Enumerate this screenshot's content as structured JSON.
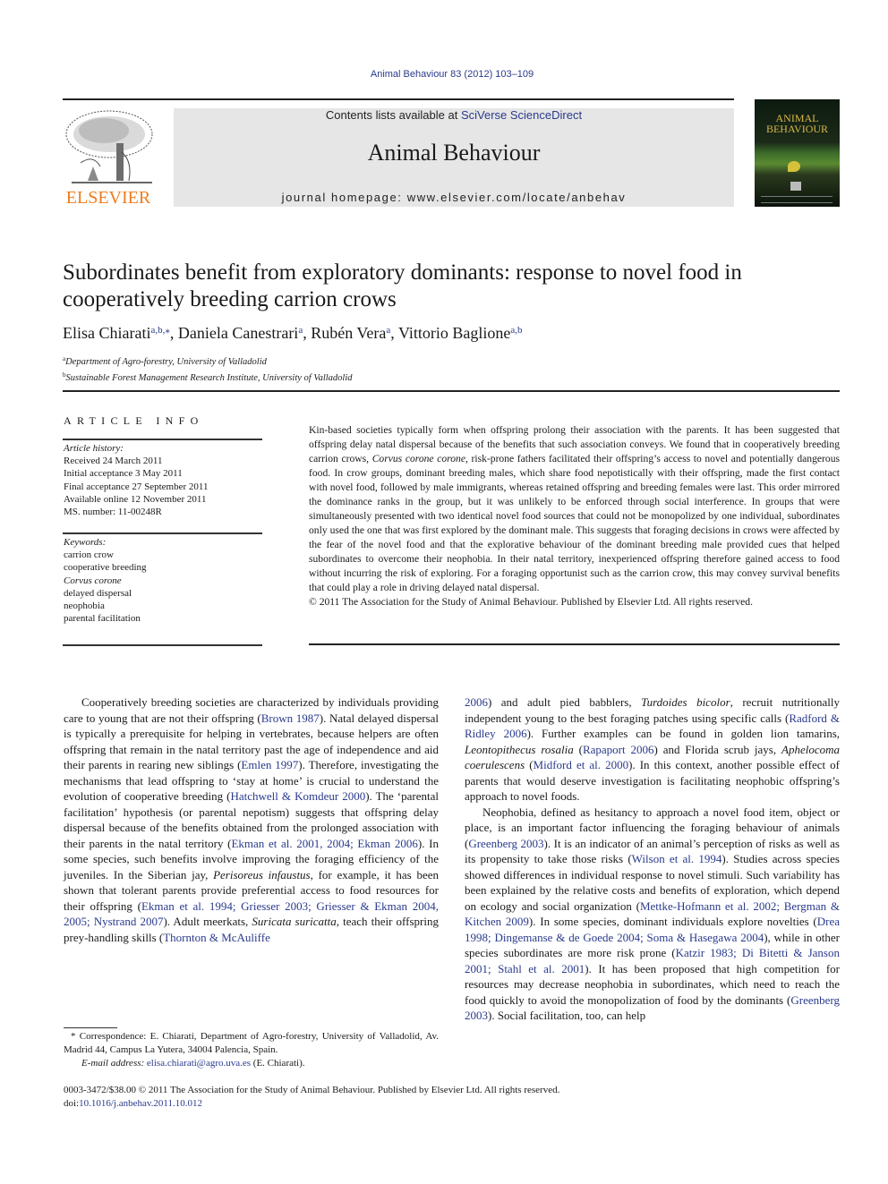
{
  "header": {
    "journal_citation": "Animal Behaviour 83 (2012) 103–109",
    "contents_prefix": "Contents lists available at ",
    "contents_link": "SciVerse ScienceDirect",
    "journal_name": "Animal Behaviour",
    "homepage_prefix": "journal homepage: ",
    "homepage_url": "www.elsevier.com/locate/anbehav",
    "publisher_logo": "ELSEVIER",
    "cover_title_line1": "ANIMAL",
    "cover_title_line2": "BEHAVIOUR"
  },
  "article": {
    "title": "Subordinates benefit from exploratory dominants: response to novel food in cooperatively breeding carrion crows",
    "authors": [
      {
        "name": "Elisa Chiarati",
        "affil": "a,b,",
        "corresponding": "⁎",
        "sep": ", "
      },
      {
        "name": "Daniela Canestrari",
        "affil": "a",
        "corresponding": "",
        "sep": ", "
      },
      {
        "name": "Rubén Vera",
        "affil": "a",
        "corresponding": "",
        "sep": ", "
      },
      {
        "name": "Vittorio Baglione",
        "affil": "a,b",
        "corresponding": "",
        "sep": ""
      }
    ],
    "affiliations": [
      {
        "mark": "a",
        "text": "Department of Agro-forestry, University of Valladolid"
      },
      {
        "mark": "b",
        "text": "Sustainable Forest Management Research Institute, University of Valladolid"
      }
    ]
  },
  "article_info": {
    "heading": "ARTICLE INFO",
    "history_label": "Article history:",
    "history": [
      "Received 24 March 2011",
      "Initial acceptance 3 May 2011",
      "Final acceptance 27 September 2011",
      "Available online 12 November 2011",
      "MS. number: 11-00248R"
    ],
    "keywords_label": "Keywords:",
    "keywords": [
      {
        "text": "carrion crow",
        "italic": false
      },
      {
        "text": "cooperative breeding",
        "italic": false
      },
      {
        "text": "Corvus corone",
        "italic": true
      },
      {
        "text": "delayed dispersal",
        "italic": false
      },
      {
        "text": "neophobia",
        "italic": false
      },
      {
        "text": "parental facilitation",
        "italic": false
      }
    ]
  },
  "abstract": {
    "p1": "Kin-based societies typically form when offspring prolong their association with the parents. It has been suggested that offspring delay natal dispersal because of the benefits that such association conveys. We found that in cooperatively breeding carrion crows, ",
    "species": "Corvus corone corone",
    "p2": ", risk-prone fathers facilitated their offspring’s access to novel and potentially dangerous food. In crow groups, dominant breeding males, which share food nepotistically with their offspring, made the first contact with novel food, followed by male immigrants, whereas retained offspring and breeding females were last. This order mirrored the dominance ranks in the group, but it was unlikely to be enforced through social interference. In groups that were simultaneously presented with two identical novel food sources that could not be monopolized by one individual, subordinates only used the one that was first explored by the dominant male. This suggests that foraging decisions in crows were affected by the fear of the novel food and that the explorative behaviour of the dominant breeding male provided cues that helped subordinates to overcome their neophobia. In their natal territory, inexperienced offspring therefore gained access to food without incurring the risk of exploring. For a foraging opportunist such as the carrion crow, this may convey survival benefits that could play a role in driving delayed natal dispersal.",
    "copyright": "© 2011 The Association for the Study of Animal Behaviour. Published by Elsevier Ltd. All rights reserved."
  },
  "body": {
    "left": [
      {
        "t": "Cooperatively breeding societies are characterized by individuals providing care to young that are not their offspring ("
      },
      {
        "link": "Brown 1987"
      },
      {
        "t": "). Natal delayed dispersal is typically a prerequisite for helping in vertebrates, because helpers are often offspring that remain in the natal territory past the age of independence and aid their parents in rearing new siblings ("
      },
      {
        "link": "Emlen 1997"
      },
      {
        "t": "). Therefore, investigating the mechanisms that lead offspring to ‘stay at home’ is crucial to understand the evolution of cooperative breeding ("
      },
      {
        "link": "Hatchwell & Komdeur 2000"
      },
      {
        "t": "). The ‘parental facilitation’ hypothesis (or parental nepotism) suggests that offspring delay dispersal because of the benefits obtained from the prolonged association with their parents in the natal territory ("
      },
      {
        "link": "Ekman et al. 2001, 2004; Ekman 2006"
      },
      {
        "t": "). In some species, such benefits involve improving the foraging efficiency of the juveniles. In the Siberian jay, "
      },
      {
        "i": "Perisoreus infaustus"
      },
      {
        "t": ", for example, it has been shown that tolerant parents provide preferential access to food resources for their offspring ("
      },
      {
        "link": "Ekman et al. 1994; Griesser 2003; Griesser & Ekman 2004, 2005; Nystrand 2007"
      },
      {
        "t": "). Adult meerkats, "
      },
      {
        "i": "Suricata suricatta"
      },
      {
        "t": ", teach their offspring prey-handling skills ("
      },
      {
        "link": "Thornton & McAuliffe"
      }
    ],
    "right_p1": [
      {
        "link": "2006"
      },
      {
        "t": ") and adult pied babblers, "
      },
      {
        "i": "Turdoides bicolor"
      },
      {
        "t": ", recruit nutritionally independent young to the best foraging patches using specific calls ("
      },
      {
        "link": "Radford & Ridley 2006"
      },
      {
        "t": "). Further examples can be found in golden lion tamarins, "
      },
      {
        "i": "Leontopithecus rosalia"
      },
      {
        "t": " ("
      },
      {
        "link": "Rapaport 2006"
      },
      {
        "t": ") and Florida scrub jays, "
      },
      {
        "i": "Aphelocoma coerulescens"
      },
      {
        "t": " ("
      },
      {
        "link": "Midford et al. 2000"
      },
      {
        "t": "). In this context, another possible effect of parents that would deserve investigation is facilitating neophobic offspring’s approach to novel foods."
      }
    ],
    "right_p2": [
      {
        "t": "Neophobia, defined as hesitancy to approach a novel food item, object or place, is an important factor influencing the foraging behaviour of animals ("
      },
      {
        "link": "Greenberg 2003"
      },
      {
        "t": "). It is an indicator of an animal’s perception of risks as well as its propensity to take those risks ("
      },
      {
        "link": "Wilson et al. 1994"
      },
      {
        "t": "). Studies across species showed differences in individual response to novel stimuli. Such variability has been explained by the relative costs and benefits of exploration, which depend on ecology and social organization ("
      },
      {
        "link": "Mettke-Hofmann et al. 2002; Bergman & Kitchen 2009"
      },
      {
        "t": "). In some species, dominant individuals explore novelties ("
      },
      {
        "link": "Drea 1998; Dingemanse & de Goede 2004; Soma & Hasegawa 2004"
      },
      {
        "t": "), while in other species subordinates are more risk prone ("
      },
      {
        "link": "Katzir 1983; Di Bitetti & Janson 2001; Stahl et al. 2001"
      },
      {
        "t": "). It has been proposed that high competition for resources may decrease neophobia in subordinates, which need to reach the food quickly to avoid the monopolization of food by the dominants ("
      },
      {
        "link": "Greenberg 2003"
      },
      {
        "t": "). Social facilitation, too, can help"
      }
    ]
  },
  "footnote": {
    "mark": "*",
    "correspondence": " Correspondence: E. Chiarati, Department of Agro-forestry, University of Valladolid, Av. Madrid 44, Campus La Yutera, 34004 Palencia, Spain.",
    "email_label": "E-mail address:",
    "email": "elisa.chiarati@agro.uva.es",
    "email_suffix": " (E. Chiarati)."
  },
  "bottom": {
    "issn_line": "0003-3472/$38.00 © 2011 The Association for the Study of Animal Behaviour. Published by Elsevier Ltd. All rights reserved.",
    "doi_label": "doi:",
    "doi": "10.1016/j.anbehav.2011.10.012"
  },
  "colors": {
    "link": "#2a3a8c",
    "elsevier_orange": "#f07c1c",
    "banner_bg": "#e6e6e6"
  }
}
